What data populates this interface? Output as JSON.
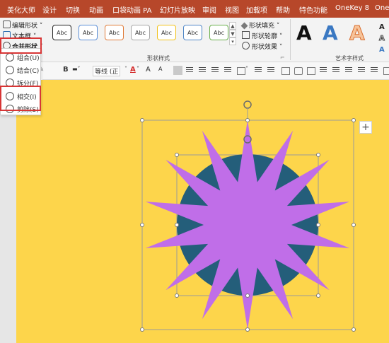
{
  "menubar": {
    "items": [
      "美化大师",
      "设计",
      "切换",
      "动画",
      "口袋动画 PA",
      "幻灯片放映",
      "审阅",
      "视图",
      "加载项",
      "帮助",
      "特色功能",
      "OneKey 8",
      "One"
    ]
  },
  "ribbon": {
    "edit_shape": "编辑形状",
    "text_box": "文本框",
    "merge_shapes": "合并形状",
    "shape_style_swatch": "Abc",
    "shape_fill": "形状填充",
    "shape_outline": "形状轮廓",
    "shape_effects": "形状效果",
    "shape_styles_label": "形状样式",
    "wordart_label": "艺术字样式",
    "wordart_letter": "A",
    "dialog_launcher": "⌐"
  },
  "toolbar2": {
    "bold": "B",
    "font_name": "等线 (正",
    "font_color": "A",
    "grow_font": "A",
    "shrink_font": "A"
  },
  "dropdown": {
    "items": [
      "组合(U)",
      "结合(C)",
      "拆分(F)",
      "相交(I)",
      "剪除(S)"
    ]
  },
  "slide": {
    "add_button": "+"
  },
  "colors": {
    "accent": "#b7472a",
    "slide_bg": "#fdd54b",
    "star_fill": "#c06ee8",
    "circle_fill": "#245e7a",
    "highlight_box": "#d73636"
  }
}
